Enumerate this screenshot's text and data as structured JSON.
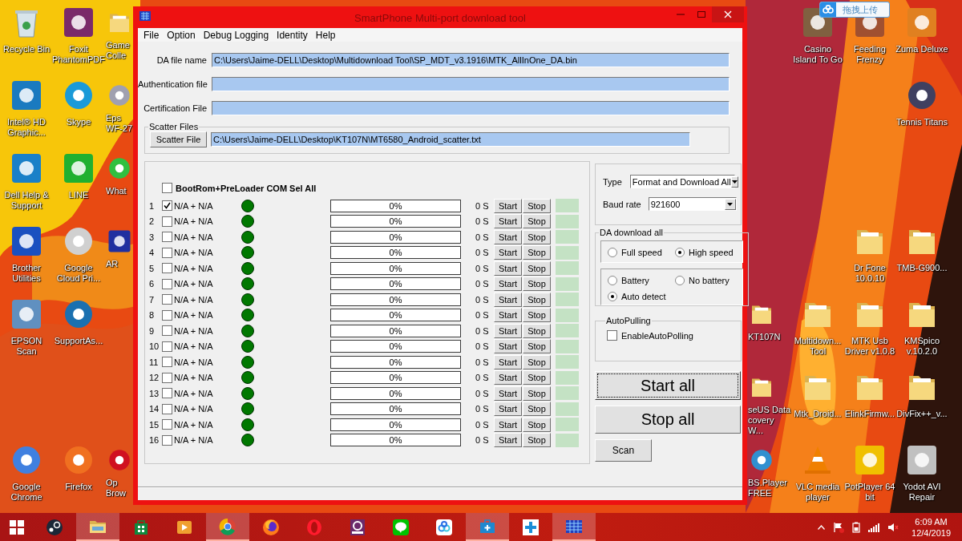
{
  "desktop": {
    "icons": [
      {
        "label": "Recycle Bin",
        "kind": "bin"
      },
      {
        "label": "Foxit PhantomPDF",
        "kind": "tile",
        "color": "#7a2a6a"
      },
      {
        "label": "Game Colle",
        "kind": "folder"
      },
      {
        "label": "Casino Island To Go",
        "kind": "tile",
        "color": "#806040"
      },
      {
        "label": "Feeding Frenzy",
        "kind": "tile",
        "color": "#a05030"
      },
      {
        "label": "Zuma Deluxe",
        "kind": "tile",
        "color": "#e08020"
      },
      {
        "label": "Intel® HD Graphic...",
        "kind": "tile",
        "color": "#1a7ac0"
      },
      {
        "label": "Skype",
        "kind": "round",
        "color": "#1a9ad8"
      },
      {
        "label": "Eps WF-27",
        "kind": "round",
        "color": "#a0a0b0"
      },
      {
        "label": "Tennis Titans",
        "kind": "round",
        "color": "#404060"
      },
      {
        "label": "Dell Help & Support",
        "kind": "tile",
        "color": "#1a80c8"
      },
      {
        "label": "LINE",
        "kind": "tile",
        "color": "#20b030"
      },
      {
        "label": "What",
        "kind": "round",
        "color": "#30c040"
      },
      {
        "label": "Brother Utilities",
        "kind": "tile",
        "color": "#1a50c0"
      },
      {
        "label": "Google Cloud Pri...",
        "kind": "round",
        "color": "#d0d0d0"
      },
      {
        "label": "AR",
        "kind": "tile",
        "color": "#2030a0"
      },
      {
        "label": "Dr Fone 10.0.10",
        "kind": "folder"
      },
      {
        "label": "TMB-G900...",
        "kind": "folder"
      },
      {
        "label": "EPSON Scan",
        "kind": "tile",
        "color": "#6090c0"
      },
      {
        "label": "SupportAs...",
        "kind": "round",
        "color": "#1a70b0"
      },
      {
        "label": "KT107N",
        "kind": "folder"
      },
      {
        "label": "Multidown... Tool",
        "kind": "folder"
      },
      {
        "label": "MTK Usb Driver v1.0.8",
        "kind": "folder"
      },
      {
        "label": "KMSpico v.10.2.0",
        "kind": "folder"
      },
      {
        "label": "seUS Data covery W...",
        "kind": "folder"
      },
      {
        "label": "Mtk_Droid...",
        "kind": "folder"
      },
      {
        "label": "ElinkFirmw...",
        "kind": "folder"
      },
      {
        "label": "DivFix++_v...",
        "kind": "folder"
      },
      {
        "label": "Google Chrome",
        "kind": "round",
        "color": "#4080e0"
      },
      {
        "label": "Firefox",
        "kind": "round",
        "color": "#f07020"
      },
      {
        "label": "Op Brow",
        "kind": "round",
        "color": "#d01020"
      },
      {
        "label": "BS.Player FREE",
        "kind": "round",
        "color": "#3090d0"
      },
      {
        "label": "VLC media player",
        "kind": "cone"
      },
      {
        "label": "PotPlayer 64 bit",
        "kind": "tile",
        "color": "#f0c000"
      },
      {
        "label": "Yodot AVI Repair",
        "kind": "tile",
        "color": "#c0c0c0"
      }
    ]
  },
  "upload_badge": {
    "label": "拖拽上传"
  },
  "window": {
    "title": "SmartPhone Multi-port download tool",
    "menu": [
      "File",
      "Option",
      "Debug Logging",
      "Identity",
      "Help"
    ],
    "files": [
      {
        "label": "DA file name",
        "value": "C:\\Users\\Jaime-DELL\\Desktop\\Multidownload Tool\\SP_MDT_v3.1916\\MTK_AllInOne_DA.bin"
      },
      {
        "label": "Authentication file"
      },
      {
        "label": "Certification File"
      }
    ],
    "scatter": {
      "legend": "Scatter Files",
      "button": "Scatter File",
      "value": "C:\\Users\\Jaime-DELL\\Desktop\\KT107N\\MT6580_Android_scatter.txt"
    },
    "select_all": {
      "label": "BootRom+PreLoader COM Sel All",
      "checked": false
    },
    "ports": [
      {
        "number": "1",
        "checked": true,
        "port": "N/A + N/A",
        "color": "#007800",
        "level": 0,
        "percent": "0%",
        "time": "0 S",
        "start": "Start",
        "stop": "Stop"
      },
      {
        "number": "2",
        "checked": false,
        "port": "N/A + N/A",
        "color": "#007800",
        "level": 0,
        "percent": "0%",
        "time": "0 S",
        "start": "Start",
        "stop": "Stop"
      },
      {
        "number": "3",
        "checked": false,
        "port": "N/A + N/A",
        "color": "#007800",
        "level": 0,
        "percent": "0%",
        "time": "0 S",
        "start": "Start",
        "stop": "Stop"
      },
      {
        "number": "4",
        "checked": false,
        "port": "N/A + N/A",
        "color": "#007800",
        "level": 0,
        "percent": "0%",
        "time": "0 S",
        "start": "Start",
        "stop": "Stop"
      },
      {
        "number": "5",
        "checked": false,
        "port": "N/A + N/A",
        "color": "#007800",
        "level": 0,
        "percent": "0%",
        "time": "0 S",
        "start": "Start",
        "stop": "Stop"
      },
      {
        "number": "6",
        "checked": false,
        "port": "N/A + N/A",
        "color": "#007800",
        "level": 0,
        "percent": "0%",
        "time": "0 S",
        "start": "Start",
        "stop": "Stop"
      },
      {
        "number": "7",
        "checked": false,
        "port": "N/A + N/A",
        "color": "#007800",
        "level": 0,
        "percent": "0%",
        "time": "0 S",
        "start": "Start",
        "stop": "Stop"
      },
      {
        "number": "8",
        "checked": false,
        "port": "N/A + N/A",
        "color": "#007800",
        "level": 0,
        "percent": "0%",
        "time": "0 S",
        "start": "Start",
        "stop": "Stop"
      },
      {
        "number": "9",
        "checked": false,
        "port": "N/A + N/A",
        "color": "#007800",
        "level": 0,
        "percent": "0%",
        "time": "0 S",
        "start": "Start",
        "stop": "Stop"
      },
      {
        "number": "10",
        "checked": false,
        "port": "N/A + N/A",
        "color": "#007800",
        "level": 0,
        "percent": "0%",
        "time": "0 S",
        "start": "Start",
        "stop": "Stop"
      },
      {
        "number": "11",
        "checked": false,
        "port": "N/A + N/A",
        "color": "#007800",
        "level": 0,
        "percent": "0%",
        "time": "0 S",
        "start": "Start",
        "stop": "Stop"
      },
      {
        "number": "12",
        "checked": false,
        "port": "N/A + N/A",
        "color": "#007800",
        "level": 0,
        "percent": "0%",
        "time": "0 S",
        "start": "Start",
        "stop": "Stop"
      },
      {
        "number": "13",
        "checked": false,
        "port": "N/A + N/A",
        "color": "#007800",
        "level": 0,
        "percent": "0%",
        "time": "0 S",
        "start": "Start",
        "stop": "Stop"
      },
      {
        "number": "14",
        "checked": false,
        "port": "N/A + N/A",
        "color": "#007800",
        "level": 0,
        "percent": "0%",
        "time": "0 S",
        "start": "Start",
        "stop": "Stop"
      },
      {
        "number": "15",
        "checked": false,
        "port": "N/A + N/A",
        "color": "#007800",
        "level": 0,
        "percent": "0%",
        "time": "0 S",
        "start": "Start",
        "stop": "Stop"
      },
      {
        "number": "16",
        "checked": false,
        "port": "N/A + N/A",
        "color": "#007800",
        "level": 0,
        "percent": "0%",
        "time": "0 S",
        "start": "Start",
        "stop": "Stop"
      }
    ],
    "settings": {
      "type_label": "Type",
      "type_value": "Format and Download All",
      "baud_label": "Baud rate",
      "baud_value": "921600"
    },
    "da_download": {
      "legend": "DA download all",
      "speed": [
        {
          "label": "Full speed",
          "selected": false
        },
        {
          "label": "High speed",
          "selected": true
        }
      ],
      "battery": [
        {
          "label": "Battery",
          "selected": false
        },
        {
          "label": "No battery",
          "selected": false
        },
        {
          "label": "Auto detect",
          "selected": true
        }
      ]
    },
    "auto_polling": {
      "legend": "AutoPulling",
      "label": "EnableAutoPolling",
      "checked": false
    },
    "big_buttons": [
      {
        "label": "Start all",
        "focused": true
      },
      {
        "label": "Stop all",
        "focused": false
      }
    ],
    "scan_button": {
      "label": "Scan"
    }
  },
  "taskbar": {
    "apps": [
      {
        "kind": "windows",
        "active": false
      },
      {
        "kind": "steam",
        "active": false
      },
      {
        "kind": "folder",
        "active": true
      },
      {
        "kind": "store",
        "active": false
      },
      {
        "kind": "media",
        "active": false
      },
      {
        "kind": "chrome",
        "active": true
      },
      {
        "kind": "firefox",
        "active": false
      },
      {
        "kind": "opera",
        "active": false
      },
      {
        "kind": "pdf",
        "active": false
      },
      {
        "kind": "line",
        "active": false
      },
      {
        "kind": "cloud",
        "active": false
      },
      {
        "kind": "toolbox",
        "active": true
      },
      {
        "kind": "plus",
        "active": false
      },
      {
        "kind": "grid",
        "active": true
      }
    ],
    "time": "6:09 AM",
    "date": "12/4/2019"
  }
}
